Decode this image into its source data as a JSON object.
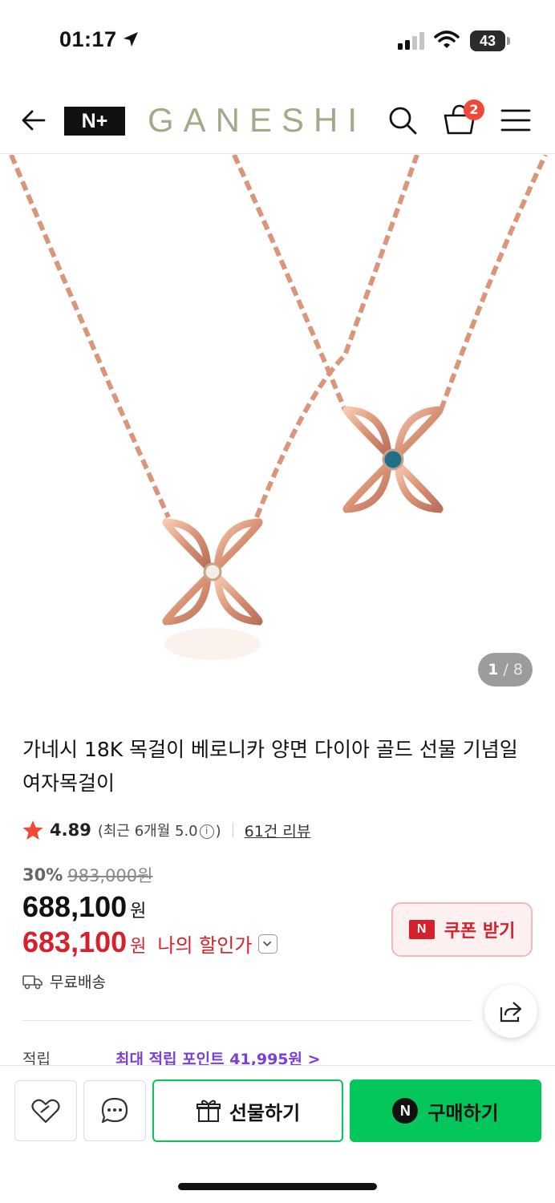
{
  "status_bar": {
    "time": "01:17",
    "battery": "43"
  },
  "header": {
    "channel_logo": "N+",
    "brand": "GANESHI",
    "cart_count": "2"
  },
  "gallery": {
    "current": "1",
    "separator": "/",
    "total": "8"
  },
  "product": {
    "title": "가네시 18K 목걸이 베로니카 양면 다이아 골드 선물 기념일 여자목걸이",
    "rating": "4.89",
    "recent_rating_prefix": "(최근 6개월 5.0",
    "recent_rating_suffix": ")",
    "review_count": "61건 리뷰",
    "discount_rate": "30%",
    "original_price": "983,000원",
    "sale_price": "688,100",
    "sale_unit": "원",
    "my_price": "683,100",
    "my_unit": "원",
    "my_price_label": "나의 할인가",
    "shipping": "무료배송",
    "points_label": "적립",
    "points_value": "최대 적립 포인트 41,995원 >"
  },
  "coupon": {
    "badge": "N",
    "label": "쿠폰 받기"
  },
  "actions": {
    "gift_label": "선물하기",
    "buy_badge": "N",
    "buy_label": "구매하기"
  },
  "colors": {
    "brand_green": "#03c75a",
    "price_red": "#d6202c",
    "points_purple": "#7a3fd6",
    "badge_red": "#f04937"
  }
}
